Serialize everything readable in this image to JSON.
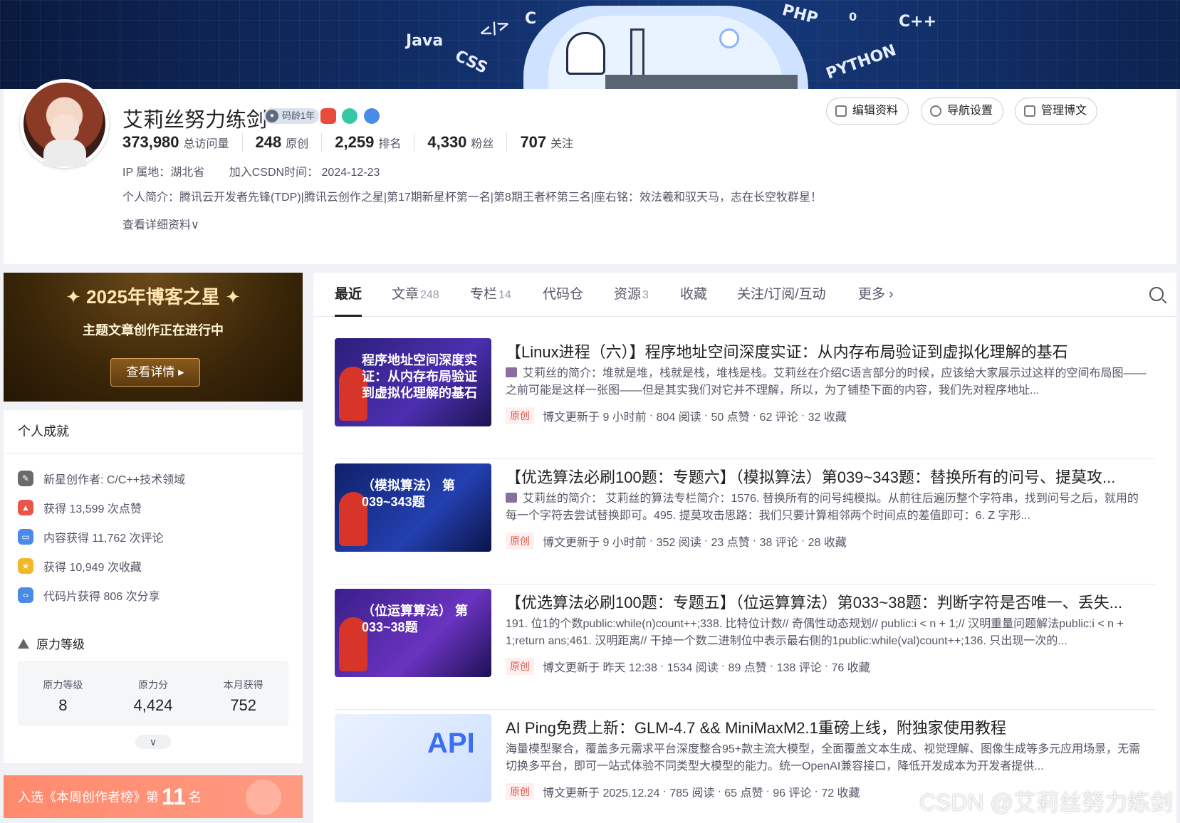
{
  "banner": {
    "languages": [
      "Java",
      "</>",
      "C",
      "CSS",
      "PHP",
      "C++",
      "PYTHON",
      "0"
    ]
  },
  "profile": {
    "username": "艾莉丝努力练剑",
    "code_age_badge": "码龄1年",
    "stats": [
      {
        "value": "373,980",
        "label": "总访问量"
      },
      {
        "value": "248",
        "label": "原创"
      },
      {
        "value": "2,259",
        "label": "排名"
      },
      {
        "value": "4,330",
        "label": "粉丝"
      },
      {
        "value": "707",
        "label": "关注"
      }
    ],
    "ip": "IP 属地：湖北省",
    "join": "加入CSDN时间： 2024-12-23",
    "intro": "个人简介：腾讯云开发者先锋(TDP)|腾讯云创作之星|第17期新星杯第一名|第8期王者杯第三名|座右铭：效法羲和驭天马，志在长空牧群星！",
    "more_info": "查看详细资料∨",
    "buttons": {
      "edit": "编辑资料",
      "nav": "导航设置",
      "manage": "管理博文"
    }
  },
  "promo": {
    "title": "✦ 2025年博客之星 ✦",
    "subtitle": "主题文章创作正在进行中",
    "button": "查看详情 ▸"
  },
  "achievements": {
    "header": "个人成就",
    "items": [
      {
        "icon": "pencil-icon",
        "text": "新星创作者: C/C++技术领域",
        "color": "#6b6b6b"
      },
      {
        "icon": "thumb-up-icon",
        "text": "获得 13,599 次点赞",
        "color": "#e8564a"
      },
      {
        "icon": "comment-icon",
        "text": "内容获得 11,762 次评论",
        "color": "#4a8be8"
      },
      {
        "icon": "star-icon",
        "text": "获得 10,949 次收藏",
        "color": "#f2b827"
      },
      {
        "icon": "code-icon",
        "text": "代码片获得 806 次分享",
        "color": "#4a8be8"
      }
    ],
    "level_header": "原力等级",
    "level": [
      {
        "key": "原力等级",
        "value": "8"
      },
      {
        "key": "原力分",
        "value": "4,424"
      },
      {
        "key": "本月获得",
        "value": "752"
      }
    ],
    "expand": "∨"
  },
  "rank_banner": {
    "prefix": "入选《本周创作者榜》第",
    "rank": "11",
    "suffix": "名"
  },
  "tabs": [
    {
      "label": "最近",
      "count": ""
    },
    {
      "label": "文章",
      "count": "248"
    },
    {
      "label": "专栏",
      "count": "14"
    },
    {
      "label": "代码仓",
      "count": ""
    },
    {
      "label": "资源",
      "count": "3"
    },
    {
      "label": "收藏",
      "count": ""
    },
    {
      "label": "关注/订阅/互动",
      "count": ""
    },
    {
      "label": "更多 ›",
      "count": ""
    }
  ],
  "articles": [
    {
      "thumb_text": "程序地址空间深度实证：从内存布局验证到虚拟化理解的基石",
      "thumb_color": "#3a2a8f",
      "title": "【Linux进程（六）】程序地址空间深度实证：从内存布局验证到虚拟化理解的基石",
      "desc": "艾莉丝的简介：堆就是堆，栈就是栈，堆栈是栈。艾莉丝在介绍C语言部分的时候，应该给大家展示过这样的空间布局图——之前可能是这样一张图——但是其实我们对它并不理解，所以，为了铺垫下面的内容，我们先对程序地址...",
      "tag": "原创",
      "updated": "博文更新于 9 小时前",
      "reads": "804 阅读",
      "likes": "50 点赞",
      "comments": "62 评论",
      "favs": "32 收藏"
    },
    {
      "thumb_text": "（模拟算法） 第039~343题",
      "thumb_color": "#1b2a7a",
      "title": "【优选算法必刷100题：专题六】（模拟算法）第039~343题：替换所有的问号、提莫攻...",
      "desc": "艾莉丝的简介： 艾莉丝的算法专栏简介：1576. 替换所有的问号纯模拟。从前往后遍历整个字符串，找到问号之后，就用的每一个字符去尝试替换即可。495. 提莫攻击思路：我们只要计算相邻两个时间点的差值即可：6. Z 字形...",
      "tag": "原创",
      "updated": "博文更新于 9 小时前",
      "reads": "352 阅读",
      "likes": "23 点赞",
      "comments": "38 评论",
      "favs": "28 收藏"
    },
    {
      "thumb_text": "（位运算算法） 第033~38题",
      "thumb_color": "#4b2a9a",
      "title": "【优选算法必刷100题：专题五】（位运算算法）第033~38题：判断字符是否唯一、丢失...",
      "desc": "191. 位1的个数public:while(n)count++;338. 比特位计数// 奇偶性动态规划// public:i < n + 1;// 汉明重量问题解法public:i < n + 1;return ans;461. 汉明距离// 干掉一个数二进制位中表示最右侧的1public:while(val)count++;136. 只出现一次的...",
      "tag": "原创",
      "updated": "博文更新于 昨天 12:38",
      "reads": "1534 阅读",
      "likes": "89 点赞",
      "comments": "138 评论",
      "favs": "76 收藏"
    },
    {
      "thumb_text": "API",
      "thumb_color": "#dce9ff",
      "title": "AI Ping免费上新：GLM-4.7 && MiniMaxM2.1重磅上线，附独家使用教程",
      "desc": "海量模型聚合，覆盖多元需求平台深度整合95+款主流大模型，全面覆盖文本生成、视觉理解、图像生成等多元应用场景，无需切换多平台，即可一站式体验不同类型大模型的能力。统一OpenAI兼容接口，降低开发成本为开发者提供...",
      "tag": "原创",
      "updated": "博文更新于 2025.12.24",
      "reads": "785 阅读",
      "likes": "65 点赞",
      "comments": "96 评论",
      "favs": "72 收藏"
    }
  ],
  "watermark": "CSDN @艾莉丝努力练剑"
}
